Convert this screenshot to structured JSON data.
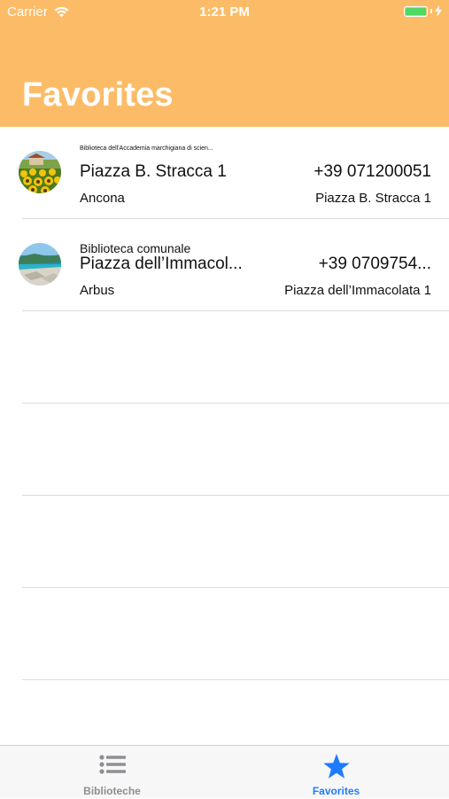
{
  "status_bar": {
    "carrier": "Carrier",
    "time": "1:21 PM",
    "battery_color": "#4cd964"
  },
  "header": {
    "title": "Favorites",
    "background": "#fcbc67"
  },
  "favorites": [
    {
      "library_name": "Biblioteca dell'Accademia marchigiana di scien...",
      "address": "Piazza B. Stracca 1",
      "phone": "+39 071200051",
      "city": "Ancona",
      "address_short": "Piazza B. Stracca 1",
      "thumbnail_icon": "sunflower-field-photo"
    },
    {
      "library_name": "Biblioteca comunale",
      "address": "Piazza dell’Immacol...",
      "phone": "+39 0709754...",
      "city": "Arbus",
      "address_short": "Piazza dell’Immacolata 1",
      "thumbnail_icon": "coastal-beach-photo"
    }
  ],
  "tabbar": {
    "tabs": [
      {
        "label": "Biblioteche",
        "icon": "list-icon",
        "selected": false
      },
      {
        "label": "Favorites",
        "icon": "star-icon",
        "selected": true
      }
    ],
    "active_color": "#1f7cff",
    "inactive_color": "#8e8e93"
  }
}
